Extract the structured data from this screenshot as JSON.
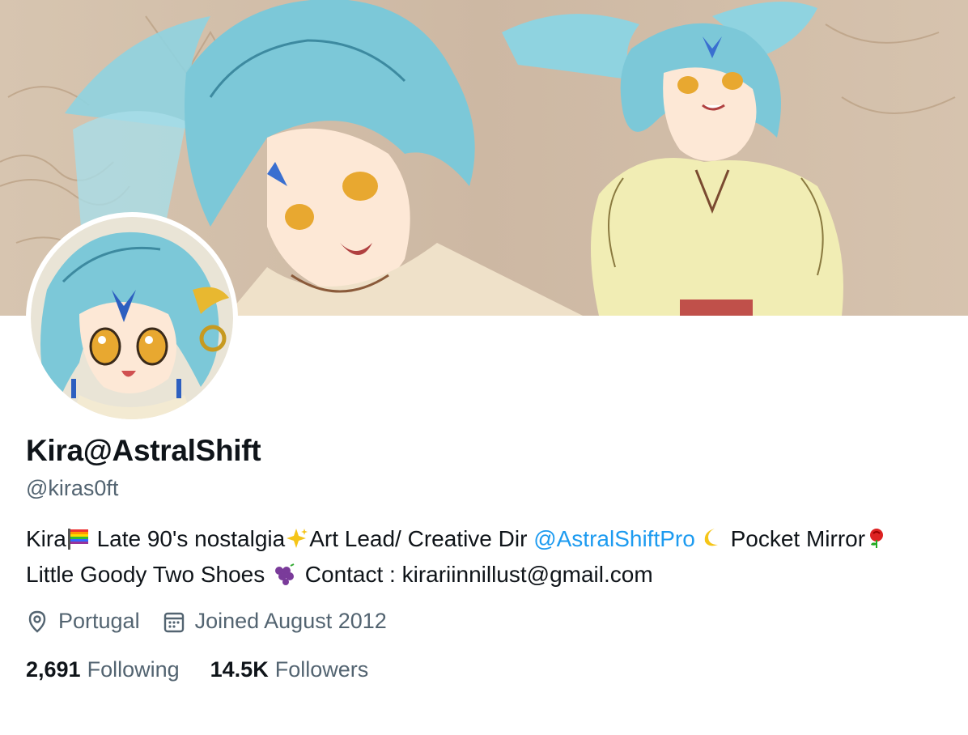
{
  "profile": {
    "display_name": "Kira@AstralShift",
    "handle": "@kiras0ft",
    "bio": {
      "part1": "Kira",
      "part2": " Late 90's nostalgia",
      "part3": "Art Lead/ Creative Dir ",
      "mention": "@AstralShiftPro",
      "part4": " Pocket Mirror",
      "part5": " Little Goody Two Shoes ",
      "part6": " Contact : kirariinnillust@gmail.com"
    },
    "location": "Portugal",
    "joined": "Joined August 2012",
    "following_count": "2,691",
    "following_label": "Following",
    "followers_count": "14.5K",
    "followers_label": "Followers"
  },
  "icons": {
    "location": "location-pin-icon",
    "calendar": "calendar-icon",
    "rainbow_flag": "rainbow-flag-icon",
    "sparkles": "sparkles-icon",
    "moon": "crescent-moon-icon",
    "rose": "rose-icon",
    "grapes": "grapes-icon"
  },
  "colors": {
    "text_primary": "#0f1419",
    "text_secondary": "#536471",
    "link": "#1d9bf0",
    "banner_bg": "#cdb9a4",
    "hair": "#7cc8d8"
  }
}
